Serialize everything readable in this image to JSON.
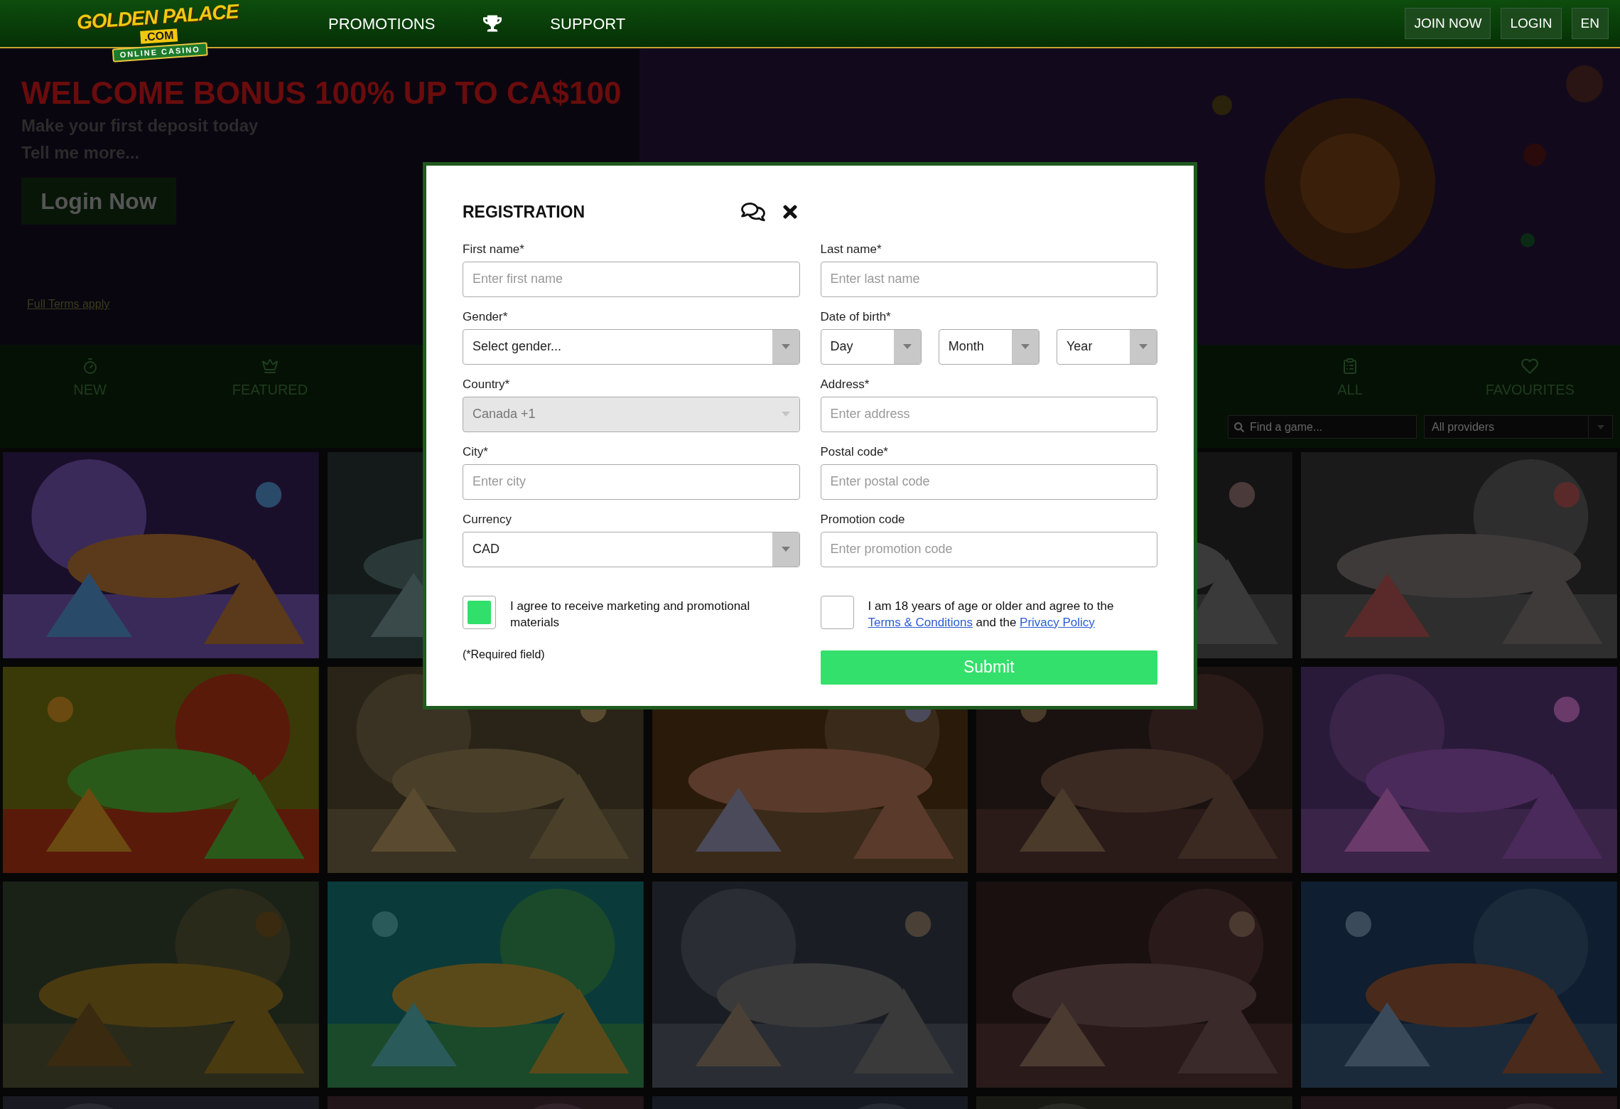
{
  "header": {
    "logo": {
      "name": "GOLDEN PALACE",
      "domain": ".COM",
      "tagline": "ONLINE CASINO"
    },
    "nav": [
      {
        "kind": "text",
        "label": "PROMOTIONS"
      },
      {
        "kind": "icon"
      },
      {
        "kind": "text",
        "label": "SUPPORT"
      }
    ],
    "actions": [
      "JOIN NOW",
      "LOGIN",
      "EN"
    ]
  },
  "hero": {
    "kind": "picture",
    "title": "WELCOME BONUS 100% UP TO CA$100",
    "subtitle": "Make your first deposit today",
    "link": "Tell me more...",
    "button": "Login Now",
    "terms": "Full Terms apply"
  },
  "categories": [
    {
      "label": "NEW"
    },
    {
      "label": "FEATURED"
    },
    {
      "label": "ALL"
    },
    {
      "label": "FAVOURITES"
    }
  ],
  "filters": {
    "search": {
      "placeholder": "Find a game..."
    },
    "provider": {
      "value": "All providers"
    }
  },
  "registration": {
    "title": "REGISTRATION",
    "fields": [
      {
        "kind": "input",
        "label": "First name*",
        "placeholder": "Enter first name",
        "disabled": false
      },
      {
        "kind": "input",
        "label": "Last name*",
        "placeholder": "Enter last name",
        "disabled": false
      },
      {
        "kind": "select",
        "label": "Gender*",
        "value": "Select gender...",
        "disabled": false
      },
      {
        "kind": "date",
        "label": "Date of birth*",
        "parts": [
          "Day",
          "Month",
          "Year"
        ],
        "disabled": false
      },
      {
        "kind": "select",
        "label": "Country*",
        "value": "Canada +1",
        "disabled": true
      },
      {
        "kind": "input",
        "label": "Address*",
        "placeholder": "Enter address",
        "disabled": false
      },
      {
        "kind": "input",
        "label": "City*",
        "placeholder": "Enter city",
        "disabled": false
      },
      {
        "kind": "input",
        "label": "Postal code*",
        "placeholder": "Enter postal code",
        "disabled": false
      },
      {
        "kind": "select",
        "label": "Currency",
        "value": "CAD",
        "disabled": false
      },
      {
        "kind": "input",
        "label": "Promotion code",
        "placeholder": "Enter promotion code",
        "disabled": false
      }
    ],
    "consents": [
      {
        "checked": true,
        "segments": [
          {
            "kind": "text",
            "text": "I agree to receive marketing and promotional materials"
          }
        ]
      },
      {
        "checked": false,
        "segments": [
          {
            "kind": "text",
            "text": "I am 18 years of age or older and agree to the "
          },
          {
            "kind": "link",
            "text": "Terms & Conditions"
          },
          {
            "kind": "text",
            "text": " and the "
          },
          {
            "kind": "link",
            "text": "Privacy Policy"
          }
        ]
      }
    ],
    "required_note": "(*Required field)",
    "submit": "Submit"
  }
}
